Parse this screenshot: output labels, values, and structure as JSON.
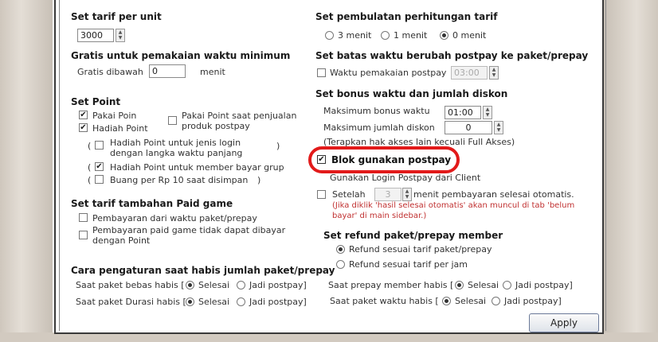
{
  "left": {
    "tarif_heading": "Set tarif per unit",
    "tarif_value": "3000",
    "gratis_heading": "Gratis untuk pemakaian waktu minimum",
    "gratis_label": "Gratis dibawah",
    "gratis_value": "0",
    "gratis_unit": "menit",
    "point_heading": "Set Point",
    "pakai_poin": "Pakai Poin",
    "hadiah_point": "Hadiah Point",
    "pakai_point_penjualan": "Pakai Point saat penjualan produk postpay",
    "hadiah_jenis_login": "Hadiah Point untuk jenis login dengan langka waktu panjang",
    "hadiah_member": "Hadiah Point untuk member bayar grup",
    "buang_per": "Buang per Rp 10 saat disimpan",
    "paren_open": "(",
    "paren_close": ")",
    "tambahan_heading": "Set tarif tambahan Paid game",
    "pembayaran_waktu": "Pembayaran dari waktu paket/prepay",
    "pembayaran_paid": "Pembayaran paid game tidak dapat dibayar dengan Point",
    "cara_heading": "Cara pengaturan saat habis jumlah paket/prepay",
    "bebas_label": "Saat paket bebas habis [",
    "durasi_label": "Saat paket Durasi habis [",
    "selesai": "Selesai",
    "jadi_postpay": "Jadi postpay]"
  },
  "right": {
    "pembulatan_heading": "Set pembulatan perhitungan tarif",
    "opt_3": "3 menit",
    "opt_1": "1 menit",
    "opt_0": "0 menit",
    "batas_heading": "Set batas waktu berubah postpay ke paket/prepay",
    "waktu_pemakaian": "Waktu pemakaian postpay",
    "batas_value": "03:00",
    "bonus_heading": "Set bonus waktu dan jumlah diskon",
    "maks_bonus": "Maksimum bonus waktu",
    "maks_bonus_value": "01:00",
    "maks_diskon": "Maksimum jumlah diskon",
    "maks_diskon_value": "0",
    "terapkan": "(Terapkan hak akses lain kecuali Full Akses)",
    "blok_postpay": "Blok gunakan postpay",
    "gunakan_login": "Gunakan Login Postpay dari Client",
    "setelah": "Setelah",
    "setelah_value": "3",
    "setelah_suffix": "menit pembayaran selesai otomatis.",
    "note": "(Jika diklik 'hasil selesai otomatis' akan muncul di tab 'belum bayar' di main sidebar.)",
    "refund_heading": "Set refund paket/prepay member",
    "refund_sesuai": "Refund sesuai tarif paket/prepay",
    "refund_jam": "Refund sesuai tarif per jam",
    "prepay_habis": "Saat prepay member habis [",
    "waktu_habis": "Saat paket waktu habis [",
    "selesai": "Selesai",
    "jadi_postpay": "Jadi postpay]",
    "apply": "Apply"
  },
  "colors": {
    "highlight": "#e21a1a",
    "note": "#c03030"
  }
}
